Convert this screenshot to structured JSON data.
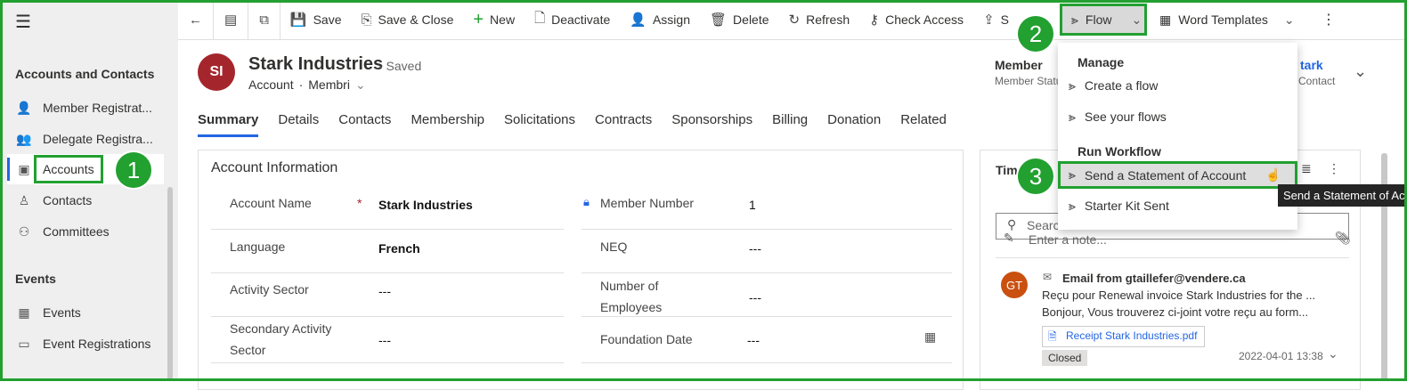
{
  "sidebar": {
    "menu_icon": "hamburger-icon",
    "sections": [
      {
        "title": "Accounts and Contacts",
        "items": [
          {
            "label": "Member Registrat...",
            "icon": "person-add-icon"
          },
          {
            "label": "Delegate Registra...",
            "icon": "people-icon"
          },
          {
            "label": "Accounts",
            "icon": "accounts-icon",
            "active": true
          },
          {
            "label": "Contacts",
            "icon": "person-icon"
          },
          {
            "label": "Committees",
            "icon": "group-icon"
          }
        ]
      },
      {
        "title": "Events",
        "items": [
          {
            "label": "Events",
            "icon": "calendar-icon"
          },
          {
            "label": "Event Registrations",
            "icon": "ticket-icon"
          }
        ]
      }
    ]
  },
  "toolbar": {
    "save": "Save",
    "save_close": "Save & Close",
    "new": "New",
    "deactivate": "Deactivate",
    "assign": "Assign",
    "delete": "Delete",
    "refresh": "Refresh",
    "check_access": "Check Access",
    "share": "S",
    "flow": "Flow",
    "word_templates": "Word Templates"
  },
  "record": {
    "initials": "SI",
    "name": "Stark Industries",
    "saved": "- Saved",
    "entity": "Account",
    "form": "Membri",
    "header_field_label": "Member",
    "header_field_sub": "Member Statu",
    "owner_name": "tark",
    "owner_sub": "Contact"
  },
  "tabs": [
    "Summary",
    "Details",
    "Contacts",
    "Membership",
    "Solicitations",
    "Contracts",
    "Sponsorships",
    "Billing",
    "Donation",
    "Related"
  ],
  "account_info": {
    "title": "Account Information",
    "fields": [
      {
        "label": "Account Name",
        "value": "Stark Industries",
        "required": "*"
      },
      {
        "label": "Language",
        "value": "French"
      },
      {
        "label": "Activity Sector",
        "value": "---"
      },
      {
        "label": "Secondary Activity Sector",
        "value": "---"
      }
    ],
    "fields_right": [
      {
        "label": "Member Number",
        "value": "1"
      },
      {
        "label": "NEQ",
        "value": "---"
      },
      {
        "label": "Number of Employees",
        "value": "---"
      },
      {
        "label": "Foundation Date",
        "value": "---"
      }
    ]
  },
  "timeline": {
    "title": "Tim",
    "search_placeholder": "Search",
    "note_placeholder": "Enter a note...",
    "item": {
      "initials": "GT",
      "title": "Email from gtaillefer@vendere.ca",
      "line1": "Reçu pour Renewal invoice Stark Industries for the ...",
      "line2": "Bonjour, Vous trouverez ci-joint votre reçu au form...",
      "attachment": "Receipt Stark Industries.pdf",
      "status": "Closed",
      "date": "2022-04-01 13:38"
    }
  },
  "flow_menu": {
    "manage_header": "Manage",
    "manage_items": [
      "Create a flow",
      "See your flows"
    ],
    "run_header": "Run Workflow",
    "run_items": [
      "Send a Statement of Account",
      "Starter Kit Sent"
    ]
  },
  "tooltip": "Send a Statement of Account",
  "badges": [
    "1",
    "2",
    "3"
  ],
  "colors": {
    "highlight": "#22a030",
    "accent": "#2266e3",
    "avatar_si": "#a4262c",
    "avatar_gt": "#ca5010"
  }
}
